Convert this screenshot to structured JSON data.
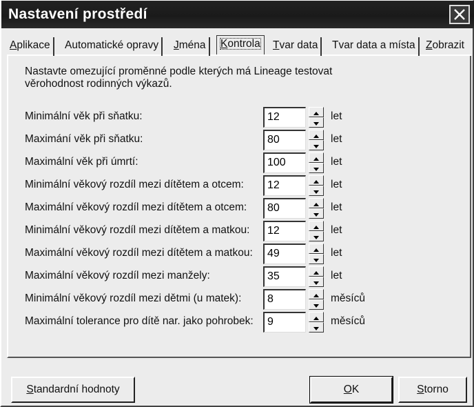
{
  "window": {
    "title": "Nastavení prostředí"
  },
  "tabs": [
    {
      "label": "Aplikace",
      "access": "A",
      "rest": "plikace"
    },
    {
      "label": "Automatické opravy",
      "access": "",
      "rest": "Automatické opravy"
    },
    {
      "label": "Jména",
      "access": "J",
      "rest": "ména"
    },
    {
      "label": "Kontrola",
      "access": "K",
      "rest": "ontrola"
    },
    {
      "label": "Tvar data",
      "access": "T",
      "rest": "var data"
    },
    {
      "label": "Tvar data a místa",
      "access": "",
      "rest": "Tvar data a místa"
    },
    {
      "label": "Zobrazit",
      "access": "Z",
      "rest": "obrazit"
    }
  ],
  "active_tab": "Kontrola",
  "intro_text": "Nastavte omezující proměnné podle kterých má Lineage testovat věrohodnost rodinných výkazů.",
  "rows": [
    {
      "label": "Minimální věk při sňatku:",
      "value": "12",
      "unit": "let"
    },
    {
      "label": "Maximání věk při sňatku:",
      "value": "80",
      "unit": "let"
    },
    {
      "label": "Maximální věk při úmrtí:",
      "value": "100",
      "unit": "let"
    },
    {
      "label": "Minimální věkový rozdíl mezi dítětem a otcem:",
      "value": "12",
      "unit": "let"
    },
    {
      "label": "Maximální věkový rozdíl mezi dítětem a otcem:",
      "value": "80",
      "unit": "let"
    },
    {
      "label": "Minimální věkový rozdíl mezi dítětem a matkou:",
      "value": "12",
      "unit": "let"
    },
    {
      "label": "Maximální věkový rozdíl mezi dítětem a matkou:",
      "value": "49",
      "unit": "let"
    },
    {
      "label": "Maximální věkový rozdíl mezi manžely:",
      "value": "35",
      "unit": "let"
    },
    {
      "label": "Minimální věkový rozdíl mezi dětmi (u matek):",
      "value": "8",
      "unit": "měsíců"
    },
    {
      "label": "Maximální tolerance pro dítě nar. jako pohrobek:",
      "value": "9",
      "unit": "měsíců"
    }
  ],
  "buttons": {
    "defaults": {
      "label": "Standardní hodnoty",
      "access": "S",
      "rest": "tandardní hodnoty"
    },
    "ok": {
      "label": "OK",
      "access": "O",
      "rest": "K"
    },
    "cancel": {
      "label": "Storno",
      "access": "S",
      "rest": "torno"
    }
  }
}
